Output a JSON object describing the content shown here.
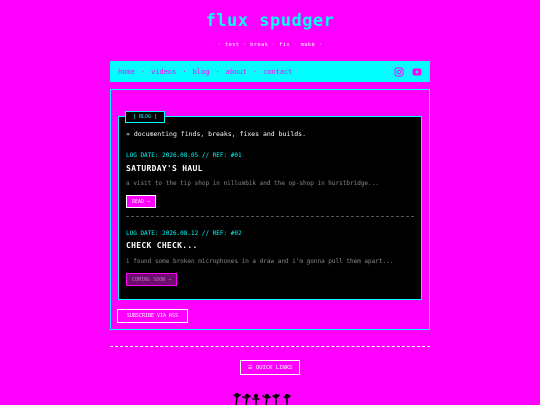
{
  "site": {
    "title": "flux spudger",
    "tagline": "· test · break · fix · make ·"
  },
  "nav": {
    "items": [
      "home",
      "videos",
      "blog",
      "about",
      "contact"
    ],
    "separator": "·",
    "icons": [
      "instagram-icon",
      "youtube-icon"
    ]
  },
  "blog": {
    "tag": "[ BLOG ]",
    "intro": "» documenting finds, breaks, fixes and builds.",
    "posts": [
      {
        "date": "LOG DATE: 2026.08.05 // REF: #01",
        "title": "SATURDAY'S HAUL",
        "excerpt": "a visit to the tip shop in nillumbik and the op-shop in hurstbridge...",
        "button": "READ →"
      },
      {
        "date": "LOG DATE: 2026.08.12 // REF: #02",
        "title": "CHECK CHECK...",
        "excerpt": "i found some broken microphones in a draw and i'm gonna pull them apart...",
        "button": "COMING SOON →"
      }
    ]
  },
  "rss": {
    "label": "SUBSCRIBE VIA RSS"
  },
  "quick_links": {
    "label": "☰ QUICK LINKS"
  },
  "colors": {
    "background": "#ff00ff",
    "accent": "#00ffff",
    "panel": "#000000"
  }
}
